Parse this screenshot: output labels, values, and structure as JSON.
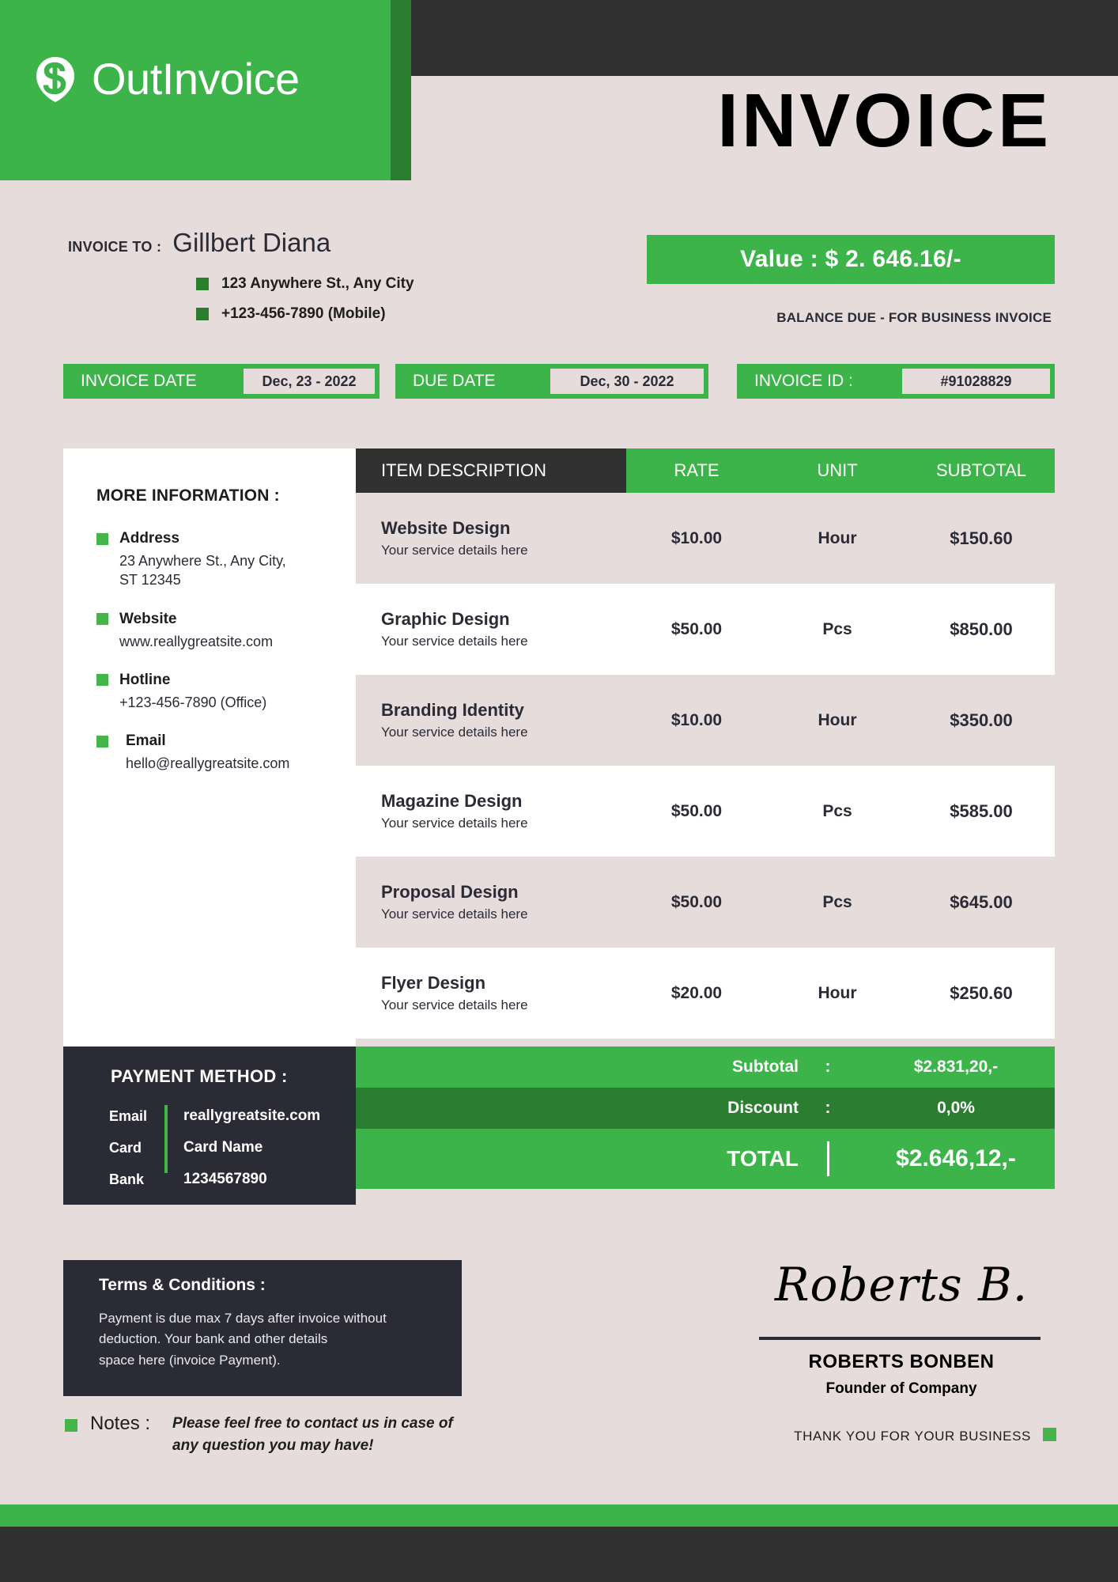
{
  "brand": {
    "logo_text": "OutInvoice",
    "logo_icon": "dollar-pin-icon",
    "green": "#3cb44a",
    "dark_green": "#2b7d30",
    "dark": "#313131",
    "panel_dark": "#2b2b36",
    "page_bg": "#e6dcdc"
  },
  "header": {
    "title": "INVOICE"
  },
  "bill_to": {
    "label": "INVOICE TO :",
    "name": "Gillbert Diana",
    "lines": [
      "123 Anywhere St., Any City",
      "+123-456-7890 (Mobile)"
    ]
  },
  "value": {
    "text": "Value : $ 2. 646.16/-",
    "caption": "BALANCE DUE - FOR BUSINESS INVOICE"
  },
  "meta_bars": [
    {
      "label": "INVOICE DATE",
      "value": "Dec, 23 - 2022"
    },
    {
      "label": "DUE DATE",
      "value": "Dec, 30 - 2022"
    },
    {
      "label": "INVOICE ID :",
      "value": "#91028829"
    }
  ],
  "more_information": {
    "title": "MORE INFORMATION :",
    "items": [
      {
        "label": "Address",
        "value": "23 Anywhere St., Any City,\nST 12345"
      },
      {
        "label": "Website",
        "value": "www.reallygreatsite.com"
      },
      {
        "label": "Hotline",
        "value": "+123-456-7890 (Office)"
      },
      {
        "label": "Email",
        "value": "hello@reallygreatsite.com"
      }
    ]
  },
  "items_table": {
    "headers": {
      "description": "ITEM DESCRIPTION",
      "rate": "RATE",
      "unit": "UNIT",
      "subtotal": "SUBTOTAL"
    },
    "rows": [
      {
        "title": "Website Design",
        "details": "Your service details here",
        "rate": "$10.00",
        "unit": "Hour",
        "subtotal": "$150.60"
      },
      {
        "title": "Graphic Design",
        "details": "Your service details here",
        "rate": "$50.00",
        "unit": "Pcs",
        "subtotal": "$850.00"
      },
      {
        "title": "Branding Identity",
        "details": "Your service details here",
        "rate": "$10.00",
        "unit": "Hour",
        "subtotal": "$350.00"
      },
      {
        "title": "Magazine Design",
        "details": "Your service details here",
        "rate": "$50.00",
        "unit": "Pcs",
        "subtotal": "$585.00"
      },
      {
        "title": "Proposal Design",
        "details": "Your service details here",
        "rate": "$50.00",
        "unit": "Pcs",
        "subtotal": "$645.00"
      },
      {
        "title": "Flyer Design",
        "details": "Your service details here",
        "rate": "$20.00",
        "unit": "Hour",
        "subtotal": "$250.60"
      }
    ]
  },
  "payment_method": {
    "title": "PAYMENT METHOD :",
    "rows": [
      {
        "key": "Email",
        "value": "reallygreatsite.com"
      },
      {
        "key": "Card",
        "value": "Card Name"
      },
      {
        "key": "Bank",
        "value": "1234567890"
      }
    ]
  },
  "totals": {
    "subtotal_label": "Subtotal",
    "subtotal_colon": ":",
    "subtotal_value": "$2.831,20,-",
    "discount_label": "Discount",
    "discount_colon": ":",
    "discount_value": "0,0%",
    "total_label": "TOTAL",
    "total_value": "$2.646,12,-"
  },
  "terms": {
    "title": "Terms & Conditions :",
    "body": "Payment is due max 7 days after invoice without deduction. Your bank and other details\nspace here (invoice Payment)."
  },
  "notes": {
    "label": "Notes :",
    "text": "Please feel free to contact us in case of\nany question you may have!"
  },
  "signature": {
    "script_name": "Roberts B.",
    "person": "ROBERTS BONBEN",
    "role": "Founder of Company",
    "thanks": "THANK YOU FOR YOUR BUSINESS"
  }
}
